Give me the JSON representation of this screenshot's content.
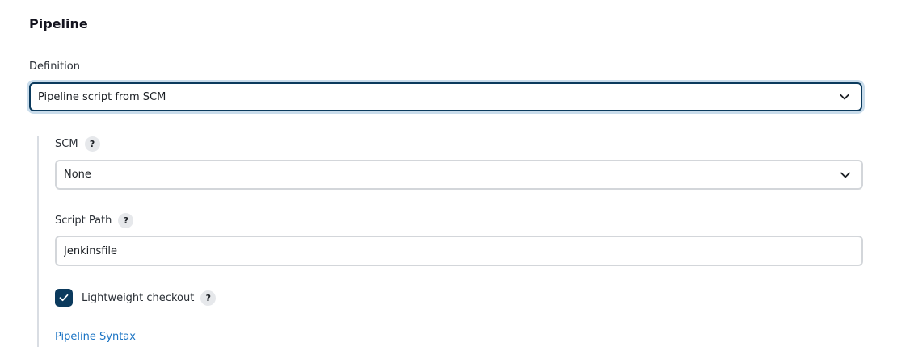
{
  "section": {
    "title": "Pipeline"
  },
  "definition": {
    "label": "Definition",
    "selected": "Pipeline script from SCM"
  },
  "scm": {
    "label": "SCM",
    "help": "?",
    "selected": "None"
  },
  "script_path": {
    "label": "Script Path",
    "help": "?",
    "value": "Jenkinsfile"
  },
  "lightweight_checkout": {
    "label": "Lightweight checkout",
    "help": "?",
    "checked": true
  },
  "pipeline_syntax": {
    "label": "Pipeline Syntax"
  },
  "colors": {
    "accent": "#0b3a5d",
    "focus_ring": "#c9dceb",
    "link": "#1b74c4"
  },
  "icons": {
    "dropdown": "chevron-down-icon",
    "check": "checkmark-icon"
  }
}
